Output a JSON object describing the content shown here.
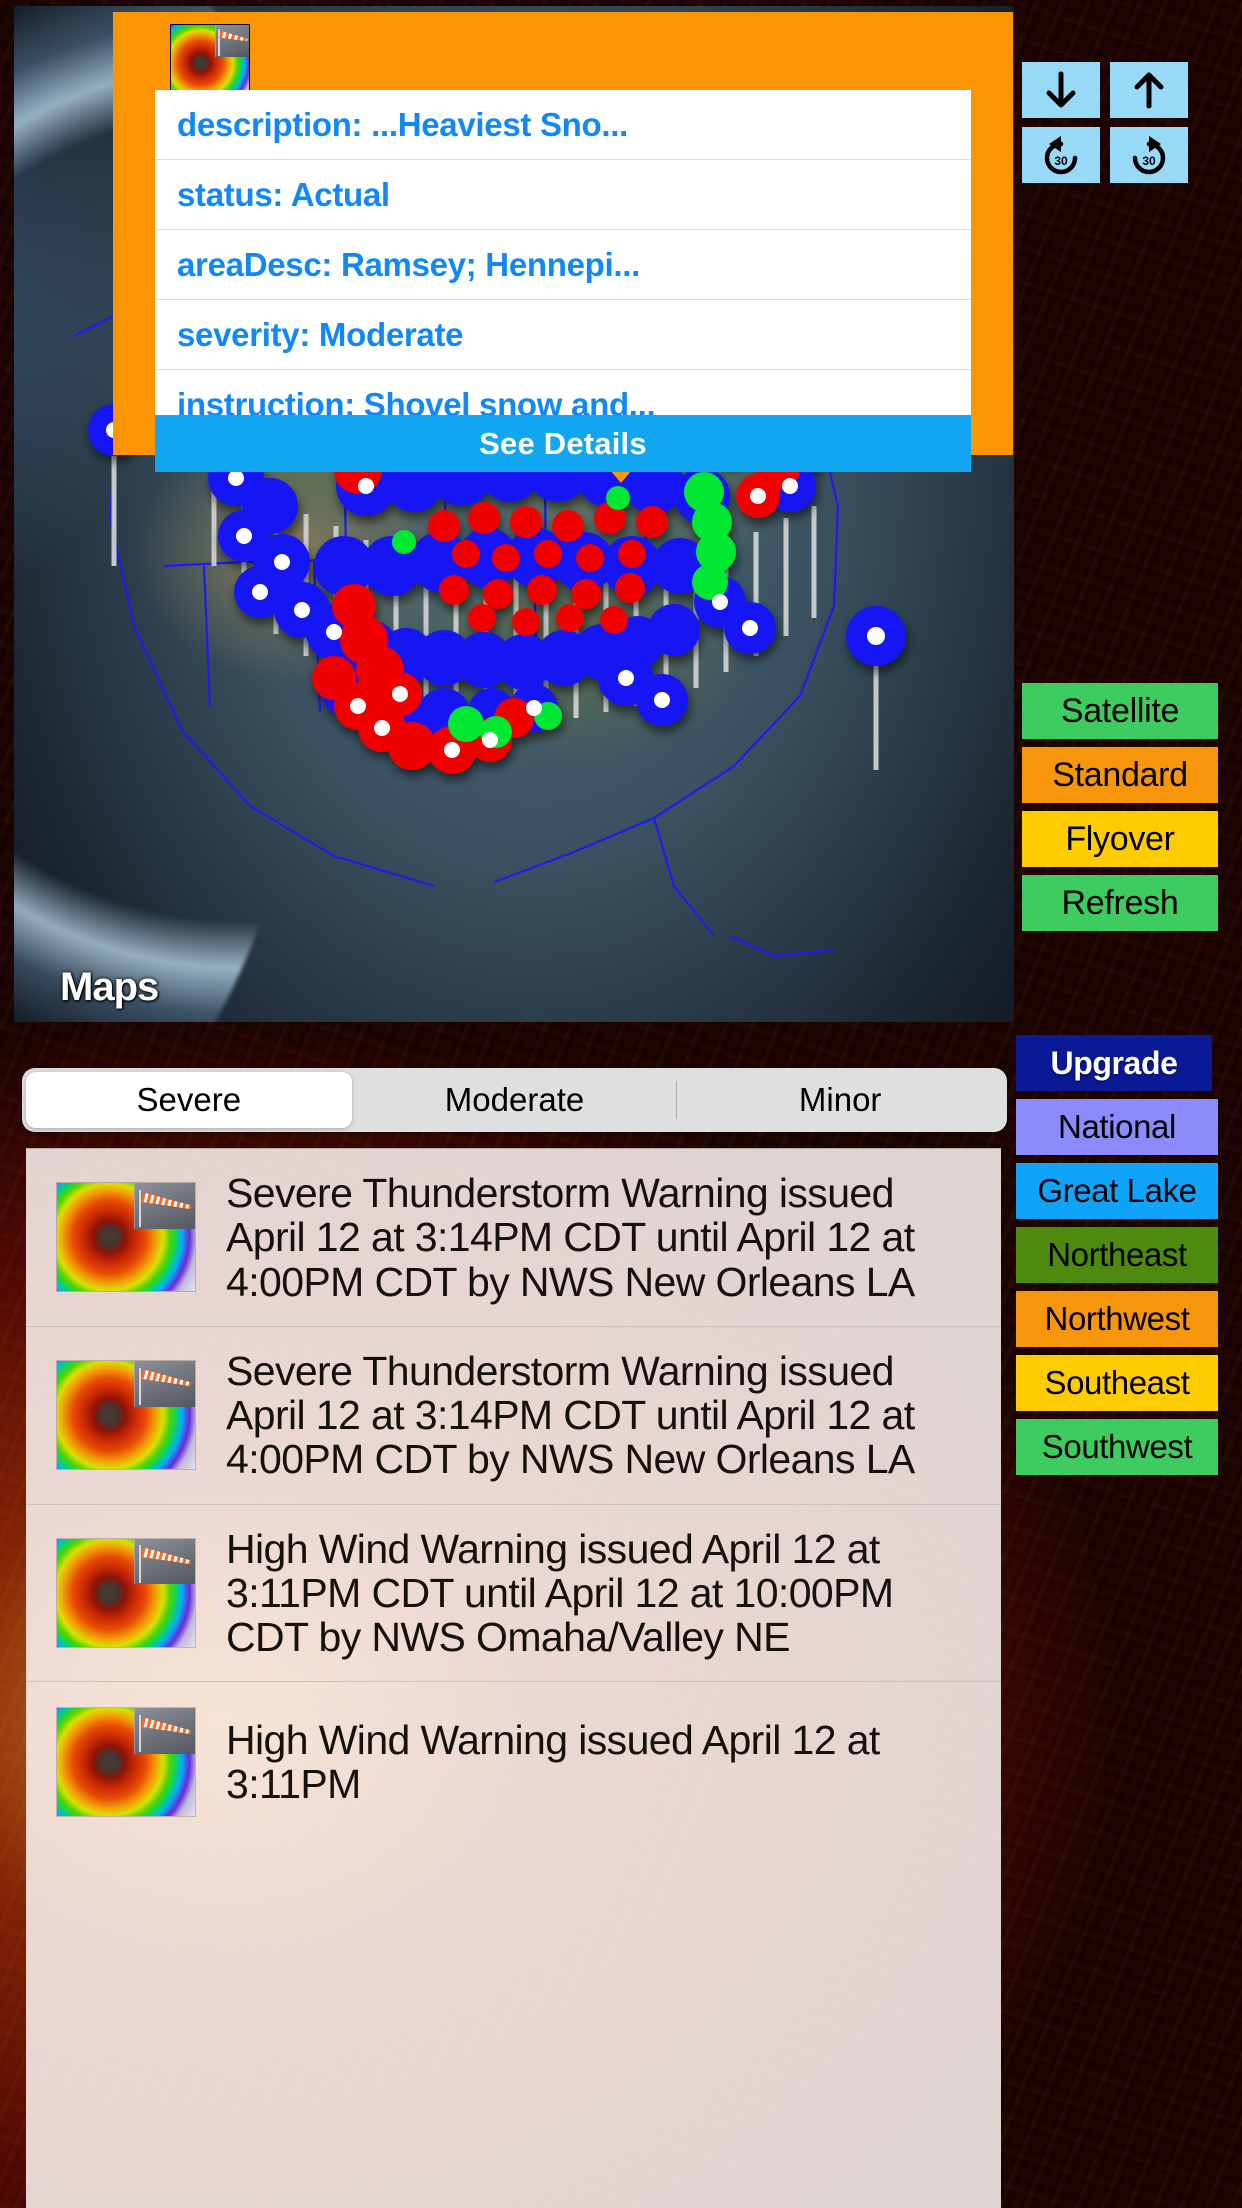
{
  "map": {
    "watermark": "Maps",
    "apple_glyph": "",
    "pin_colors": {
      "severe": "#f20000",
      "moderate": "#1414f5",
      "minor": "#00e832"
    }
  },
  "callout": {
    "thumbnail_icon": "radar-hurricane-thumbnail",
    "rows": [
      {
        "label": "description: ...Heaviest Sno..."
      },
      {
        "label": "status: Actual"
      },
      {
        "label": "areaDesc: Ramsey; Hennepi..."
      },
      {
        "label": "severity: Moderate"
      },
      {
        "label": "instruction: Shovel snow and..."
      }
    ],
    "button_label": "See Details",
    "background_color": "#FB9504",
    "button_color": "#12A6F0",
    "text_color": "#1188FA"
  },
  "nav_buttons": [
    {
      "name": "scroll-down-button",
      "icon": "arrow-down-icon"
    },
    {
      "name": "scroll-up-button",
      "icon": "arrow-up-icon"
    },
    {
      "name": "rewind-30-button",
      "icon": "rewind-30-icon",
      "value": "30"
    },
    {
      "name": "forward-30-button",
      "icon": "forward-30-icon",
      "value": "30"
    }
  ],
  "map_style_buttons": [
    {
      "label": "Satellite",
      "color": "#3ECC60"
    },
    {
      "label": "Standard",
      "color": "#F8960B"
    },
    {
      "label": "Flyover",
      "color": "#FFCC00"
    },
    {
      "label": "Refresh",
      "color": "#3ECC60"
    }
  ],
  "region_buttons": [
    {
      "label": "Upgrade",
      "color": "#0A1A96"
    },
    {
      "label": "National",
      "color": "#8B8BFB"
    },
    {
      "label": "Great Lake",
      "color": "#10A3FA"
    },
    {
      "label": "Northeast",
      "color": "#4D8A0D"
    },
    {
      "label": "Northwest",
      "color": "#F8960B"
    },
    {
      "label": "Southeast",
      "color": "#FFCC00"
    },
    {
      "label": "Southwest",
      "color": "#3ECC60"
    }
  ],
  "severity_filter": {
    "options": [
      "Severe",
      "Moderate",
      "Minor"
    ],
    "selected": "Severe"
  },
  "alerts": [
    {
      "text": "Severe Thunderstorm Warning issued April 12 at 3:14PM CDT until April 12 at 4:00PM CDT by NWS New Orleans LA"
    },
    {
      "text": "Severe Thunderstorm Warning issued April 12 at 3:14PM CDT until April 12 at 4:00PM CDT by NWS New Orleans LA"
    },
    {
      "text": "High Wind Warning issued April 12 at 3:11PM CDT until April 12 at 10:00PM CDT by NWS Omaha/Valley NE"
    },
    {
      "text": "High Wind Warning issued April 12 at 3:11PM"
    }
  ]
}
